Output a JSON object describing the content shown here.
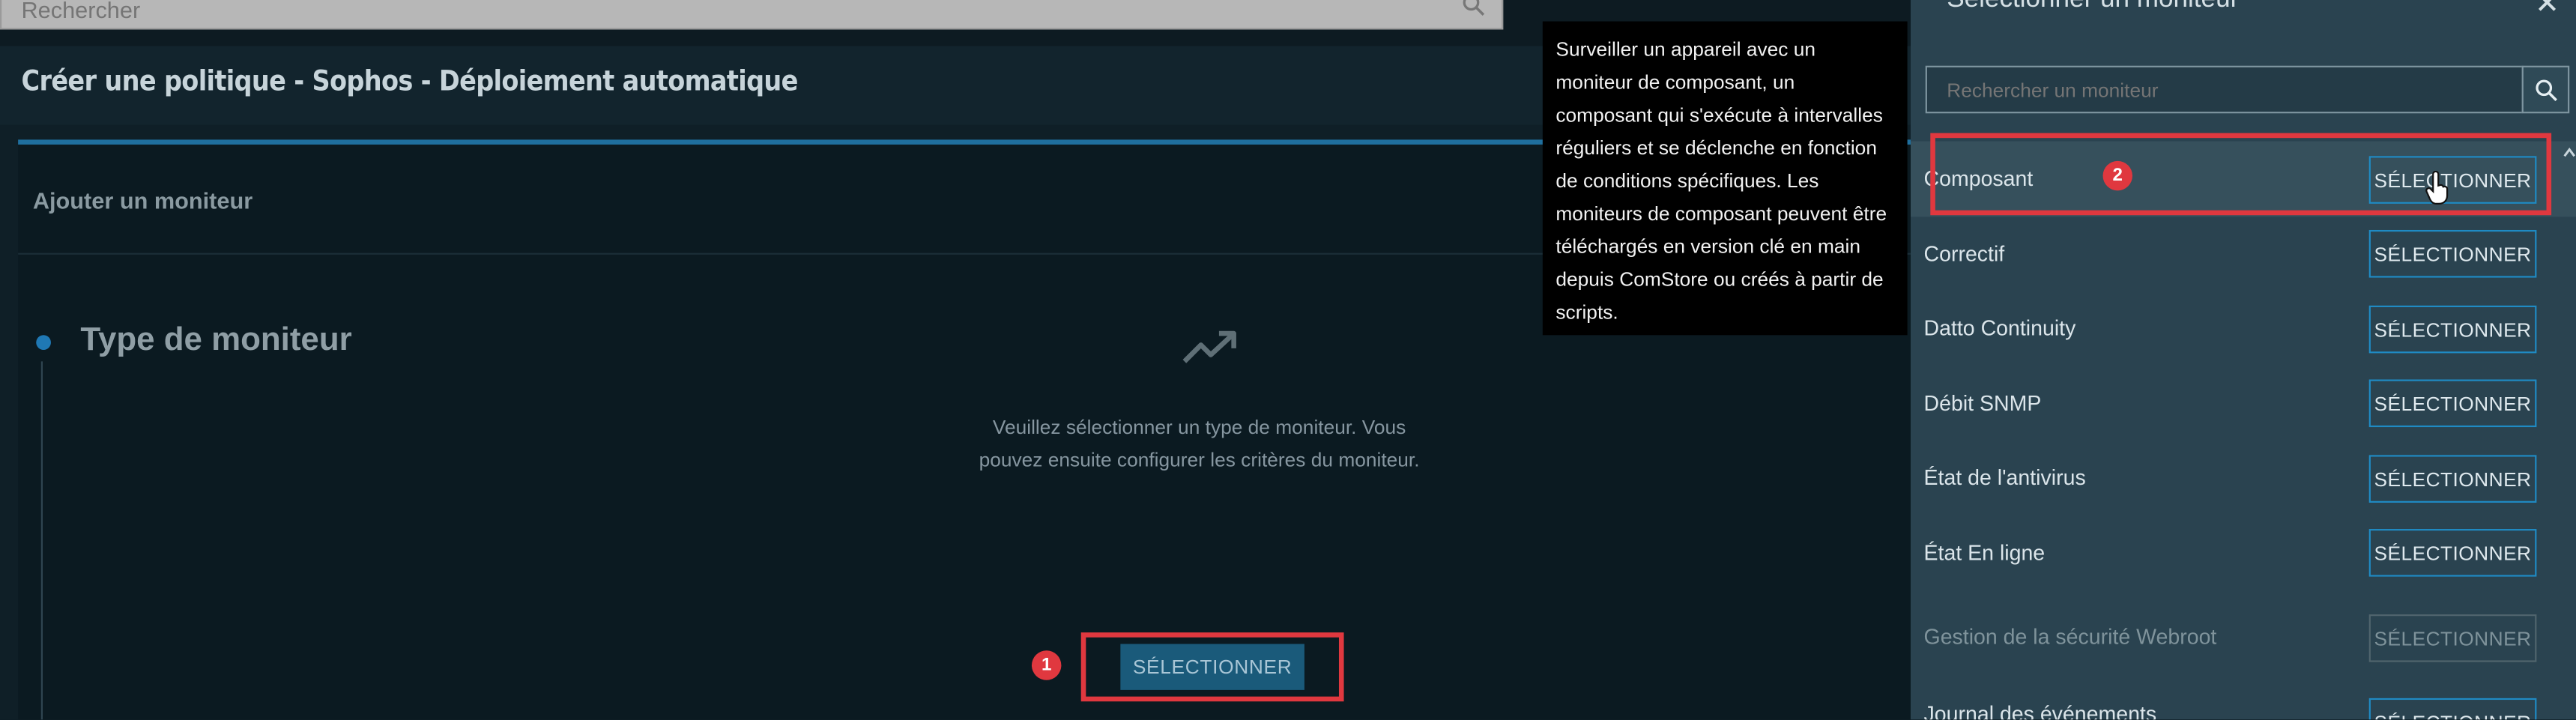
{
  "top_search": {
    "placeholder": "Rechercher"
  },
  "page_title": "Créer une politique - Sophos - Déploiement automatique",
  "card": {
    "header": "Ajouter un moniteur",
    "step_title": "Type de moniteur",
    "empty_line1": "Veuillez sélectionner un type de moniteur. Vous",
    "empty_line2": "pouvez ensuite configurer les critères du moniteur.",
    "select_button": "SÉLECTIONNER"
  },
  "tooltip": {
    "lines": [
      "Surveiller un appareil avec un",
      "moniteur de composant, un",
      "composant qui s'exécute à intervalles",
      "réguliers et se déclenche en fonction",
      "de conditions spécifiques. Les",
      "moniteurs de composant peuvent être",
      "téléchargés en version clé en main",
      "depuis ComStore ou créés à partir de",
      "scripts."
    ]
  },
  "panel": {
    "title": "Sélectionner un moniteur",
    "close_icon": "close-icon",
    "search_placeholder": "Rechercher un moniteur",
    "items": [
      {
        "label": "Composant",
        "button": "SÉLECTIONNER",
        "disabled": false
      },
      {
        "label": "Correctif",
        "button": "SÉLECTIONNER",
        "disabled": false
      },
      {
        "label": "Datto Continuity",
        "button": "SÉLECTIONNER",
        "disabled": false
      },
      {
        "label": "Débit SNMP",
        "button": "SÉLECTIONNER",
        "disabled": false
      },
      {
        "label": "État de l'antivirus",
        "button": "SÉLECTIONNER",
        "disabled": false
      },
      {
        "label": "État En ligne",
        "button": "SÉLECTIONNER",
        "disabled": false
      },
      {
        "label": "Gestion de la sécurité Webroot",
        "button": "SÉLECTIONNER",
        "disabled": true
      },
      {
        "label": "Journal des événements",
        "button": "SÉLECTIONNER",
        "disabled": false
      }
    ]
  },
  "annotations": {
    "badge_1": "1",
    "badge_2": "2"
  },
  "colors": {
    "highlight": "#e0383f",
    "accent": "#1f8ac3",
    "panel": "#2a4350"
  }
}
